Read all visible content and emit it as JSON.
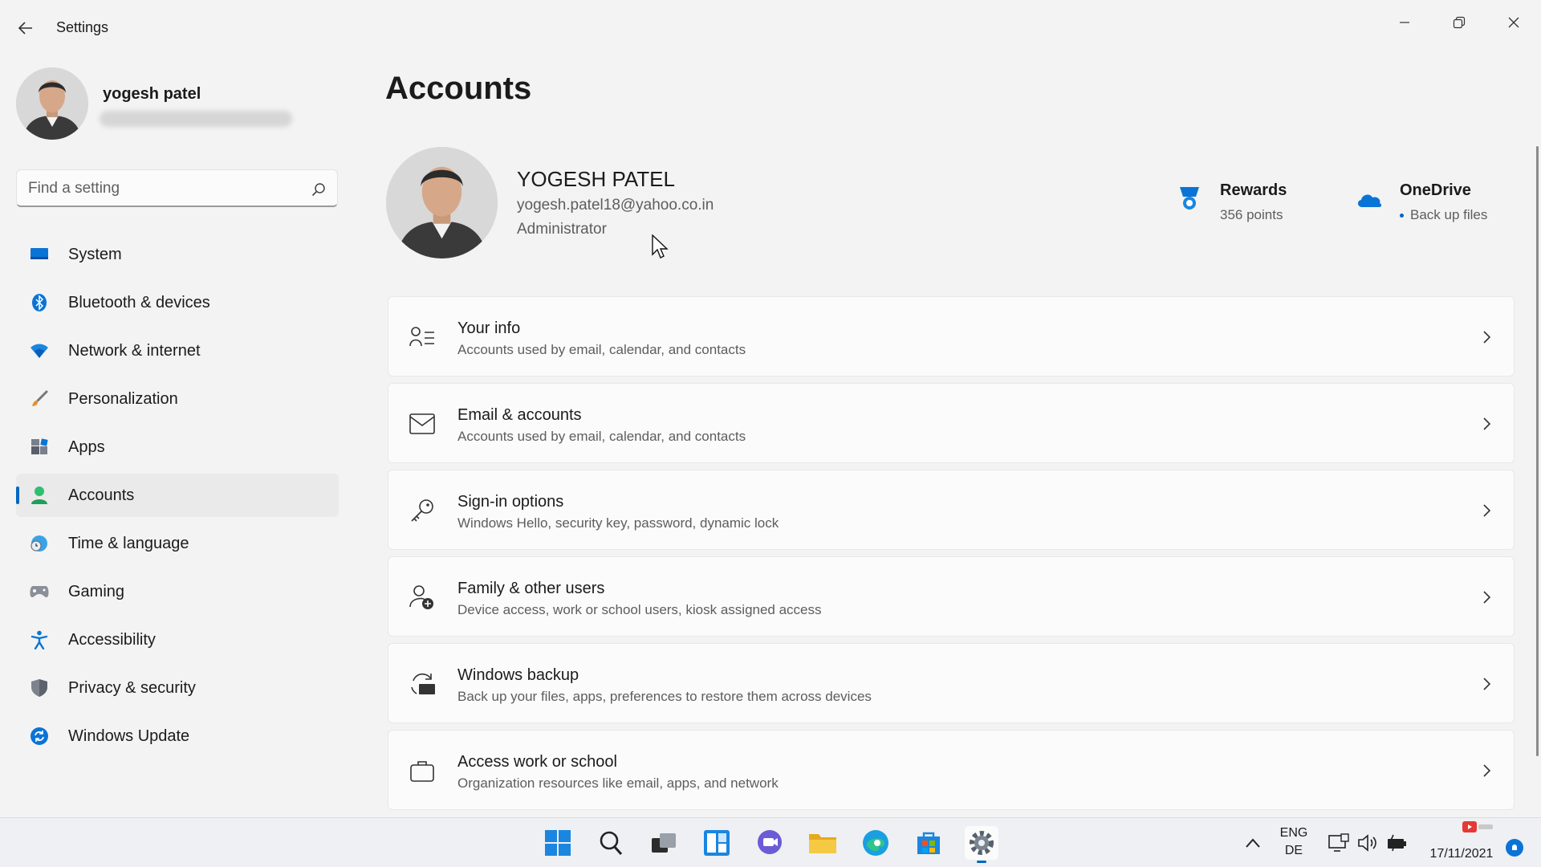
{
  "window": {
    "title": "Settings"
  },
  "profile": {
    "name": "yogesh patel"
  },
  "search": {
    "placeholder": "Find a setting"
  },
  "sidebar": {
    "items": [
      {
        "label": "System",
        "icon": "monitor-icon",
        "active": false
      },
      {
        "label": "Bluetooth & devices",
        "icon": "bluetooth-icon",
        "active": false
      },
      {
        "label": "Network & internet",
        "icon": "wifi-icon",
        "active": false
      },
      {
        "label": "Personalization",
        "icon": "brush-icon",
        "active": false
      },
      {
        "label": "Apps",
        "icon": "apps-icon",
        "active": false
      },
      {
        "label": "Accounts",
        "icon": "person-icon",
        "active": true
      },
      {
        "label": "Time & language",
        "icon": "globe-clock-icon",
        "active": false
      },
      {
        "label": "Gaming",
        "icon": "gamepad-icon",
        "active": false
      },
      {
        "label": "Accessibility",
        "icon": "accessibility-icon",
        "active": false
      },
      {
        "label": "Privacy & security",
        "icon": "shield-icon",
        "active": false
      },
      {
        "label": "Windows Update",
        "icon": "update-icon",
        "active": false
      }
    ]
  },
  "main": {
    "title": "Accounts",
    "user": {
      "name": "YOGESH PATEL",
      "email": "yogesh.patel18@yahoo.co.in",
      "role": "Administrator"
    },
    "rewards": {
      "title": "Rewards",
      "subtitle": "356 points"
    },
    "onedrive": {
      "title": "OneDrive",
      "subtitle": "Back up files"
    },
    "cards": [
      {
        "title": "Your info",
        "subtitle": "Accounts used by email, calendar, and contacts",
        "icon": "person-list-icon"
      },
      {
        "title": "Email & accounts",
        "subtitle": "Accounts used by email, calendar, and contacts",
        "icon": "mail-icon"
      },
      {
        "title": "Sign-in options",
        "subtitle": "Windows Hello, security key, password, dynamic lock",
        "icon": "key-icon"
      },
      {
        "title": "Family & other users",
        "subtitle": "Device access, work or school users, kiosk assigned access",
        "icon": "person-add-icon"
      },
      {
        "title": "Windows backup",
        "subtitle": "Back up your files, apps, preferences to restore them across devices",
        "icon": "backup-icon"
      },
      {
        "title": "Access work or school",
        "subtitle": "Organization resources like email, apps, and network",
        "icon": "briefcase-icon"
      }
    ]
  },
  "taskbar": {
    "lang_line1": "ENG",
    "lang_line2": "DE",
    "date": "17/11/2021"
  },
  "colors": {
    "accent": "#0067c0",
    "background": "#f3f3f3",
    "card": "#fbfbfb"
  }
}
